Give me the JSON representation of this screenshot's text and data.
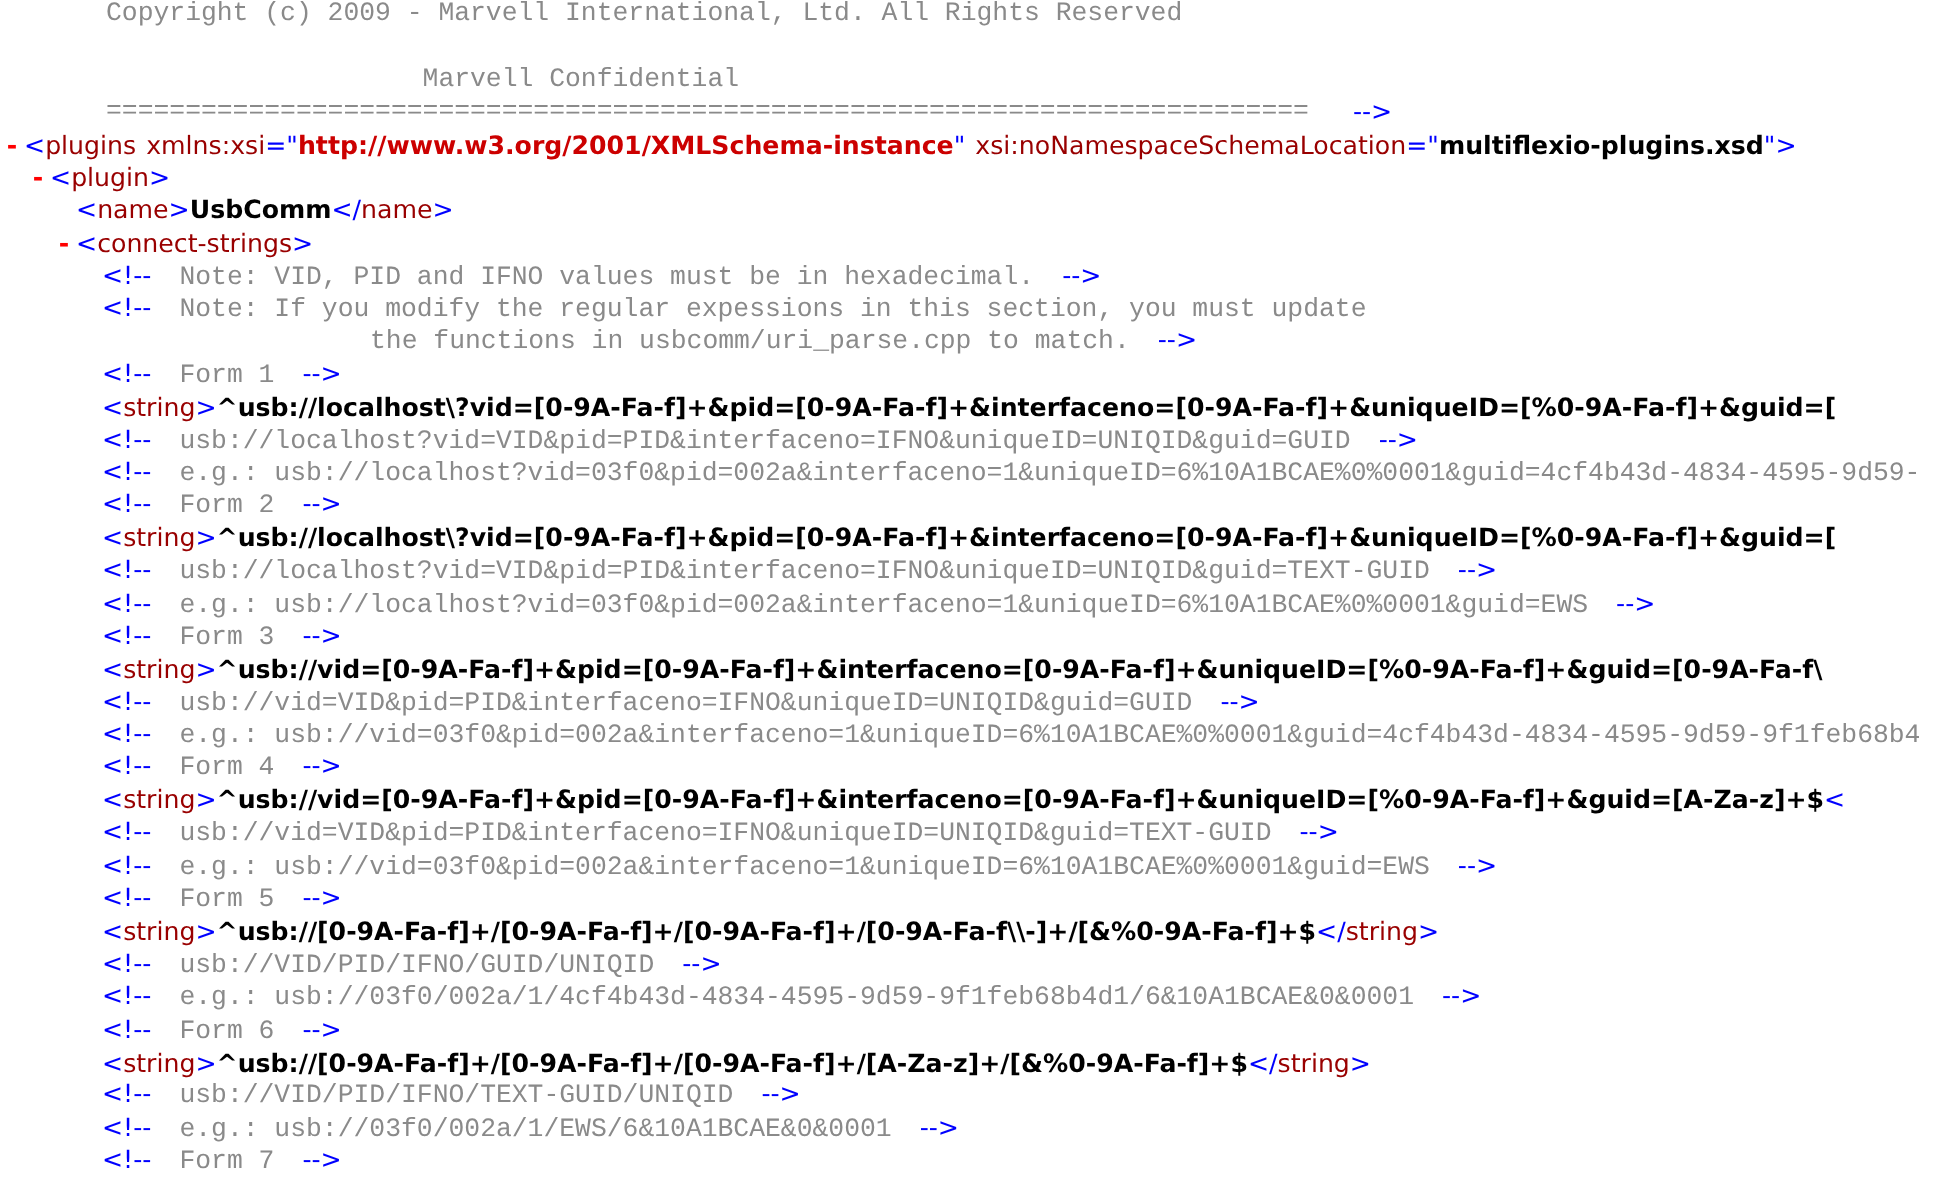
{
  "prolog_comment": {
    "lines": [
      "Copyright (c) 2009 - Marvell International, Ltd. All Rights Reserved",
      "                    Marvell Confidential",
      "============================================================================"
    ],
    "close": "-->"
  },
  "tree": [
    {
      "toggle": "-",
      "expanded": true,
      "tokens": [
        {
          "kind": "markup",
          "text": "<"
        },
        {
          "kind": "tag",
          "text": "plugins"
        },
        {
          "kind": "attr",
          "text": "xmlns:xsi"
        },
        {
          "kind": "markup",
          "text": "=\""
        },
        {
          "kind": "ns-value",
          "text": "http://www.w3.org/2001/XMLSchema-instance"
        },
        {
          "kind": "markup",
          "text": "\""
        },
        {
          "kind": "attr",
          "text": "xsi:noNamespaceSchemaLocation"
        },
        {
          "kind": "markup",
          "text": "=\""
        },
        {
          "kind": "value",
          "text": "multiflexio-plugins.xsd"
        },
        {
          "kind": "markup",
          "text": "\">"
        }
      ],
      "children": [
        {
          "toggle": "-",
          "expanded": true,
          "tokens": [
            {
              "kind": "markup",
              "text": "<"
            },
            {
              "kind": "tag",
              "text": "plugin"
            },
            {
              "kind": "markup",
              "text": ">"
            }
          ],
          "children": [
            {
              "tokens": [
                {
                  "kind": "markup",
                  "text": "<"
                },
                {
                  "kind": "tag",
                  "text": "name"
                },
                {
                  "kind": "markup",
                  "text": ">"
                },
                {
                  "kind": "value",
                  "text": "UsbComm"
                },
                {
                  "kind": "markup",
                  "text": "</"
                },
                {
                  "kind": "tag",
                  "text": "name"
                },
                {
                  "kind": "markup",
                  "text": ">"
                }
              ]
            },
            {
              "toggle": "-",
              "expanded": true,
              "tokens": [
                {
                  "kind": "markup",
                  "text": "<"
                },
                {
                  "kind": "tag",
                  "text": "connect-strings"
                },
                {
                  "kind": "markup",
                  "text": ">"
                }
              ],
              "children": [
                {
                  "tokens": [
                    {
                      "kind": "markup",
                      "text": "<!--"
                    },
                    {
                      "kind": "comment",
                      "text": "Note: VID, PID and IFNO values must be in hexadecimal."
                    },
                    {
                      "kind": "markup",
                      "text": "-->"
                    }
                  ]
                },
                {
                  "tokens": [
                    {
                      "kind": "markup",
                      "text": "<!--"
                    },
                    {
                      "kind": "comment",
                      "text": "Note: If you modify the regular expessions in this section, you must update"
                    }
                  ]
                },
                {
                  "tokens": [
                    {
                      "kind": "comment-cont",
                      "text": "the functions in usbcomm/uri_parse.cpp to match."
                    },
                    {
                      "kind": "markup",
                      "text": "-->"
                    }
                  ]
                },
                {
                  "tokens": [
                    {
                      "kind": "markup",
                      "text": "<!--"
                    },
                    {
                      "kind": "comment",
                      "text": "Form 1"
                    },
                    {
                      "kind": "markup",
                      "text": "-->"
                    }
                  ]
                },
                {
                  "tokens": [
                    {
                      "kind": "markup",
                      "text": "<"
                    },
                    {
                      "kind": "tag",
                      "text": "string"
                    },
                    {
                      "kind": "markup",
                      "text": ">"
                    },
                    {
                      "kind": "value",
                      "text": "^usb://localhost\\?vid=[0-9A-Fa-f]+&pid=[0-9A-Fa-f]+&interfaceno=[0-9A-Fa-f]+&uniqueID=[%0-9A-Fa-f]+&guid=["
                    }
                  ]
                },
                {
                  "tokens": [
                    {
                      "kind": "markup",
                      "text": "<!--"
                    },
                    {
                      "kind": "comment",
                      "text": "usb://localhost?vid=VID&pid=PID&interfaceno=IFNO&uniqueID=UNIQID&guid=GUID"
                    },
                    {
                      "kind": "markup",
                      "text": "-->"
                    }
                  ]
                },
                {
                  "tokens": [
                    {
                      "kind": "markup",
                      "text": "<!--"
                    },
                    {
                      "kind": "comment",
                      "text": "e.g.: usb://localhost?vid=03f0&pid=002a&interfaceno=1&uniqueID=6%10A1BCAE%0%0001&guid=4cf4b43d-4834-4595-9d59-"
                    }
                  ]
                },
                {
                  "tokens": [
                    {
                      "kind": "markup",
                      "text": "<!--"
                    },
                    {
                      "kind": "comment",
                      "text": "Form 2"
                    },
                    {
                      "kind": "markup",
                      "text": "-->"
                    }
                  ]
                },
                {
                  "tokens": [
                    {
                      "kind": "markup",
                      "text": "<"
                    },
                    {
                      "kind": "tag",
                      "text": "string"
                    },
                    {
                      "kind": "markup",
                      "text": ">"
                    },
                    {
                      "kind": "value",
                      "text": "^usb://localhost\\?vid=[0-9A-Fa-f]+&pid=[0-9A-Fa-f]+&interfaceno=[0-9A-Fa-f]+&uniqueID=[%0-9A-Fa-f]+&guid=["
                    }
                  ]
                },
                {
                  "tokens": [
                    {
                      "kind": "markup",
                      "text": "<!--"
                    },
                    {
                      "kind": "comment",
                      "text": "usb://localhost?vid=VID&pid=PID&interfaceno=IFNO&uniqueID=UNIQID&guid=TEXT-GUID"
                    },
                    {
                      "kind": "markup",
                      "text": "-->"
                    }
                  ]
                },
                {
                  "tokens": [
                    {
                      "kind": "markup",
                      "text": "<!--"
                    },
                    {
                      "kind": "comment",
                      "text": "e.g.: usb://localhost?vid=03f0&pid=002a&interfaceno=1&uniqueID=6%10A1BCAE%0%0001&guid=EWS"
                    },
                    {
                      "kind": "markup",
                      "text": "-->"
                    }
                  ]
                },
                {
                  "tokens": [
                    {
                      "kind": "markup",
                      "text": "<!--"
                    },
                    {
                      "kind": "comment",
                      "text": "Form 3"
                    },
                    {
                      "kind": "markup",
                      "text": "-->"
                    }
                  ]
                },
                {
                  "tokens": [
                    {
                      "kind": "markup",
                      "text": "<"
                    },
                    {
                      "kind": "tag",
                      "text": "string"
                    },
                    {
                      "kind": "markup",
                      "text": ">"
                    },
                    {
                      "kind": "value",
                      "text": "^usb://vid=[0-9A-Fa-f]+&pid=[0-9A-Fa-f]+&interfaceno=[0-9A-Fa-f]+&uniqueID=[%0-9A-Fa-f]+&guid=[0-9A-Fa-f\\"
                    }
                  ]
                },
                {
                  "tokens": [
                    {
                      "kind": "markup",
                      "text": "<!--"
                    },
                    {
                      "kind": "comment",
                      "text": "usb://vid=VID&pid=PID&interfaceno=IFNO&uniqueID=UNIQID&guid=GUID"
                    },
                    {
                      "kind": "markup",
                      "text": "-->"
                    }
                  ]
                },
                {
                  "tokens": [
                    {
                      "kind": "markup",
                      "text": "<!--"
                    },
                    {
                      "kind": "comment",
                      "text": "e.g.: usb://vid=03f0&pid=002a&interfaceno=1&uniqueID=6%10A1BCAE%0%0001&guid=4cf4b43d-4834-4595-9d59-9f1feb68b4"
                    }
                  ]
                },
                {
                  "tokens": [
                    {
                      "kind": "markup",
                      "text": "<!--"
                    },
                    {
                      "kind": "comment",
                      "text": "Form 4"
                    },
                    {
                      "kind": "markup",
                      "text": "-->"
                    }
                  ]
                },
                {
                  "tokens": [
                    {
                      "kind": "markup",
                      "text": "<"
                    },
                    {
                      "kind": "tag",
                      "text": "string"
                    },
                    {
                      "kind": "markup",
                      "text": ">"
                    },
                    {
                      "kind": "value",
                      "text": "^usb://vid=[0-9A-Fa-f]+&pid=[0-9A-Fa-f]+&interfaceno=[0-9A-Fa-f]+&uniqueID=[%0-9A-Fa-f]+&guid=[A-Za-z]+$"
                    },
                    {
                      "kind": "markup",
                      "text": "<"
                    }
                  ]
                },
                {
                  "tokens": [
                    {
                      "kind": "markup",
                      "text": "<!--"
                    },
                    {
                      "kind": "comment",
                      "text": "usb://vid=VID&pid=PID&interfaceno=IFNO&uniqueID=UNIQID&guid=TEXT-GUID"
                    },
                    {
                      "kind": "markup",
                      "text": "-->"
                    }
                  ]
                },
                {
                  "tokens": [
                    {
                      "kind": "markup",
                      "text": "<!--"
                    },
                    {
                      "kind": "comment",
                      "text": "e.g.: usb://vid=03f0&pid=002a&interfaceno=1&uniqueID=6%10A1BCAE%0%0001&guid=EWS"
                    },
                    {
                      "kind": "markup",
                      "text": "-->"
                    }
                  ]
                },
                {
                  "tokens": [
                    {
                      "kind": "markup",
                      "text": "<!--"
                    },
                    {
                      "kind": "comment",
                      "text": "Form 5"
                    },
                    {
                      "kind": "markup",
                      "text": "-->"
                    }
                  ]
                },
                {
                  "tokens": [
                    {
                      "kind": "markup",
                      "text": "<"
                    },
                    {
                      "kind": "tag",
                      "text": "string"
                    },
                    {
                      "kind": "markup",
                      "text": ">"
                    },
                    {
                      "kind": "value",
                      "text": "^usb://[0-9A-Fa-f]+/[0-9A-Fa-f]+/[0-9A-Fa-f]+/[0-9A-Fa-f\\\\-]+/[&%0-9A-Fa-f]+$"
                    },
                    {
                      "kind": "markup",
                      "text": "</"
                    },
                    {
                      "kind": "tag",
                      "text": "string"
                    },
                    {
                      "kind": "markup",
                      "text": ">"
                    }
                  ]
                },
                {
                  "tokens": [
                    {
                      "kind": "markup",
                      "text": "<!--"
                    },
                    {
                      "kind": "comment",
                      "text": "usb://VID/PID/IFNO/GUID/UNIQID"
                    },
                    {
                      "kind": "markup",
                      "text": "-->"
                    }
                  ]
                },
                {
                  "tokens": [
                    {
                      "kind": "markup",
                      "text": "<!--"
                    },
                    {
                      "kind": "comment",
                      "text": "e.g.: usb://03f0/002a/1/4cf4b43d-4834-4595-9d59-9f1feb68b4d1/6&10A1BCAE&0&0001"
                    },
                    {
                      "kind": "markup",
                      "text": "-->"
                    }
                  ]
                },
                {
                  "tokens": [
                    {
                      "kind": "markup",
                      "text": "<!--"
                    },
                    {
                      "kind": "comment",
                      "text": "Form 6"
                    },
                    {
                      "kind": "markup",
                      "text": "-->"
                    }
                  ]
                },
                {
                  "tokens": [
                    {
                      "kind": "markup",
                      "text": "<"
                    },
                    {
                      "kind": "tag",
                      "text": "string"
                    },
                    {
                      "kind": "markup",
                      "text": ">"
                    },
                    {
                      "kind": "value",
                      "text": "^usb://[0-9A-Fa-f]+/[0-9A-Fa-f]+/[0-9A-Fa-f]+/[A-Za-z]+/[&%0-9A-Fa-f]+$"
                    },
                    {
                      "kind": "markup",
                      "text": "</"
                    },
                    {
                      "kind": "tag",
                      "text": "string"
                    },
                    {
                      "kind": "markup",
                      "text": ">"
                    }
                  ]
                },
                {
                  "tokens": [
                    {
                      "kind": "markup",
                      "text": "<!--"
                    },
                    {
                      "kind": "comment",
                      "text": "usb://VID/PID/IFNO/TEXT-GUID/UNIQID"
                    },
                    {
                      "kind": "markup",
                      "text": "-->"
                    }
                  ]
                },
                {
                  "tokens": [
                    {
                      "kind": "markup",
                      "text": "<!--"
                    },
                    {
                      "kind": "comment",
                      "text": "e.g.: usb://03f0/002a/1/EWS/6&10A1BCAE&0&0001"
                    },
                    {
                      "kind": "markup",
                      "text": "-->"
                    }
                  ]
                },
                {
                  "tokens": [
                    {
                      "kind": "markup",
                      "text": "<!--"
                    },
                    {
                      "kind": "comment",
                      "text": "Form 7"
                    },
                    {
                      "kind": "markup",
                      "text": "-->"
                    }
                  ]
                }
              ]
            }
          ]
        }
      ]
    }
  ]
}
